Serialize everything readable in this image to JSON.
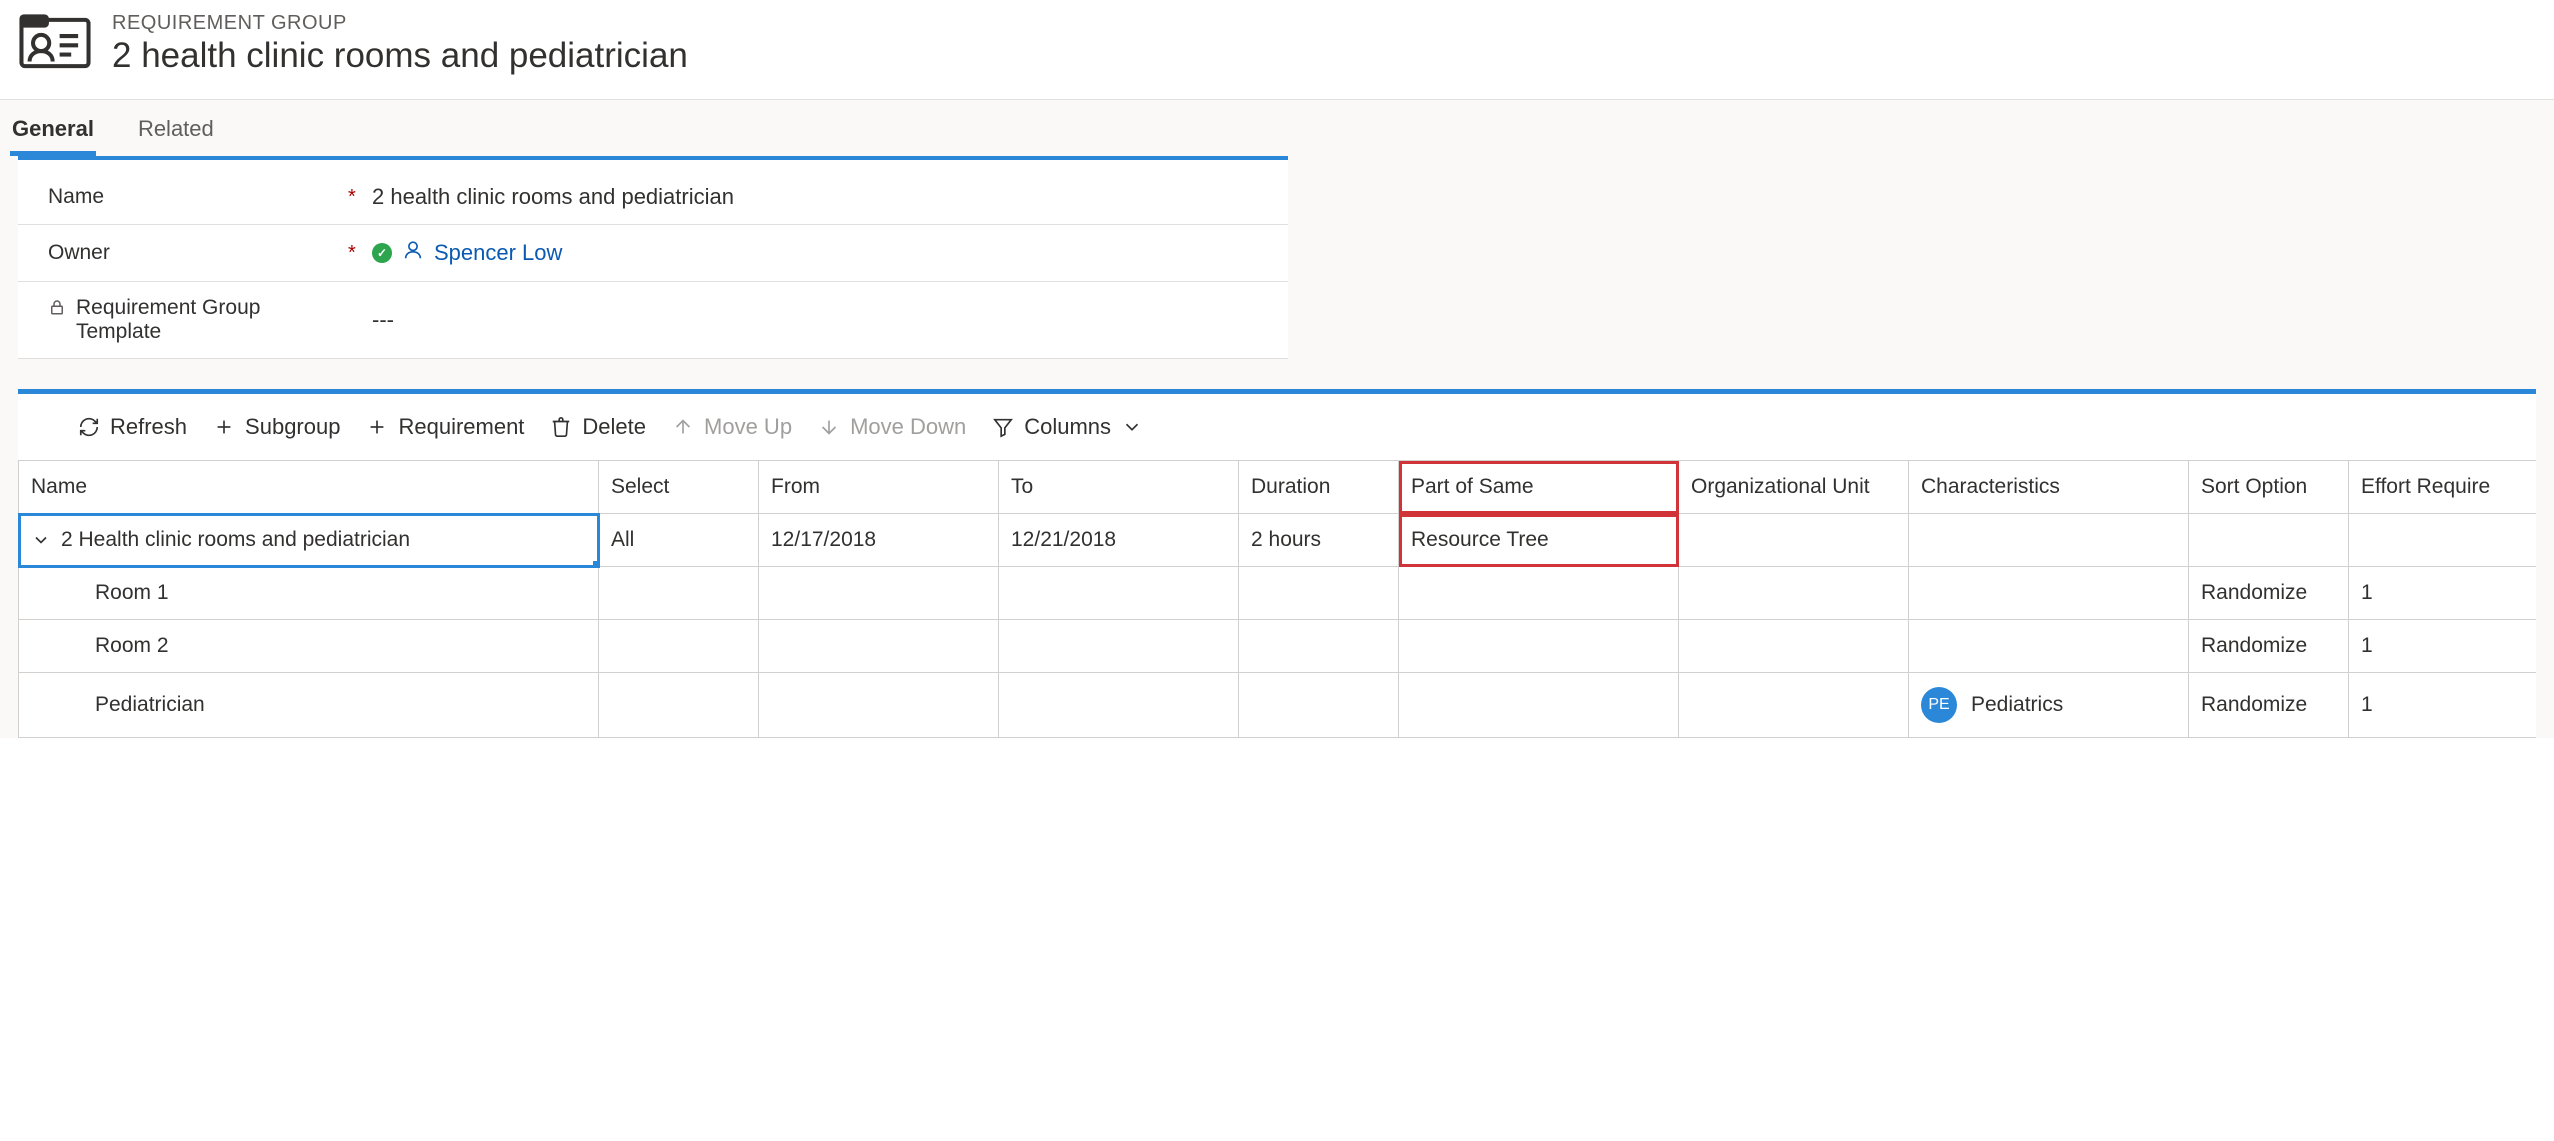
{
  "header": {
    "eyebrow": "REQUIREMENT GROUP",
    "title": "2 health clinic rooms and pediatrician"
  },
  "tabs": [
    {
      "label": "General",
      "active": true
    },
    {
      "label": "Related",
      "active": false
    }
  ],
  "form": {
    "name_field": {
      "label": "Name",
      "required": true,
      "value": "2 health clinic rooms and pediatrician"
    },
    "owner_field": {
      "label": "Owner",
      "required": true,
      "value": "Spencer Low"
    },
    "template_field": {
      "label": "Requirement Group Template",
      "locked": true,
      "value": "---"
    }
  },
  "toolbar": {
    "refresh": "Refresh",
    "subgroup": "Subgroup",
    "requirement": "Requirement",
    "delete": "Delete",
    "moveup": "Move Up",
    "movedown": "Move Down",
    "columns": "Columns"
  },
  "grid": {
    "columns": {
      "name": "Name",
      "select": "Select",
      "from": "From",
      "to": "To",
      "duration": "Duration",
      "part_of_same": "Part of Same",
      "org_unit": "Organizational Unit",
      "characteristics": "Characteristics",
      "sort_option": "Sort Option",
      "effort_required": "Effort Require"
    },
    "rows": [
      {
        "name": "2 Health clinic rooms and pediatrician",
        "level": 0,
        "expanded": true,
        "select": "All",
        "from": "12/17/2018",
        "to": "12/21/2018",
        "duration": "2 hours",
        "part_of_same": "Resource Tree",
        "org_unit": "",
        "characteristics": "",
        "char_chip": "",
        "sort_option": "",
        "effort_required": "",
        "selected_cell": true,
        "highlight_part": true
      },
      {
        "name": "Room 1",
        "level": 1,
        "select": "",
        "from": "",
        "to": "",
        "duration": "",
        "part_of_same": "",
        "org_unit": "",
        "characteristics": "",
        "char_chip": "",
        "sort_option": "Randomize",
        "effort_required": "1"
      },
      {
        "name": "Room 2",
        "level": 1,
        "select": "",
        "from": "",
        "to": "",
        "duration": "",
        "part_of_same": "",
        "org_unit": "",
        "characteristics": "",
        "char_chip": "",
        "sort_option": "Randomize",
        "effort_required": "1"
      },
      {
        "name": "Pediatrician",
        "level": 1,
        "select": "",
        "from": "",
        "to": "",
        "duration": "",
        "part_of_same": "",
        "org_unit": "",
        "characteristics": "Pediatrics",
        "char_chip": "PE",
        "sort_option": "Randomize",
        "effort_required": "1"
      }
    ]
  }
}
